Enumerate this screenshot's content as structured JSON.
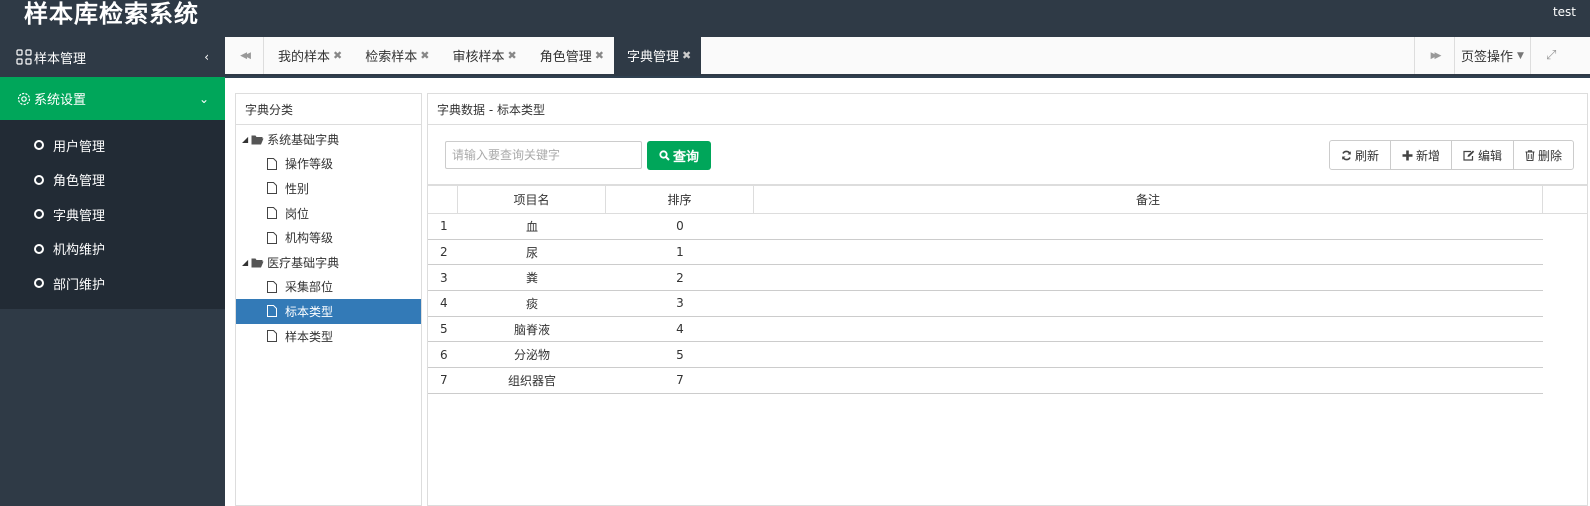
{
  "header": {
    "app_title": "样本库检索系统",
    "user": "test"
  },
  "sidebar": {
    "groups": [
      {
        "label": "样本管理",
        "arrow": "‹"
      },
      {
        "label": "系统设置",
        "arrow": "⌄"
      }
    ],
    "items": [
      {
        "label": "用户管理"
      },
      {
        "label": "角色管理"
      },
      {
        "label": "字典管理"
      },
      {
        "label": "机构维护"
      },
      {
        "label": "部门维护"
      }
    ]
  },
  "tabs": {
    "items": [
      {
        "label": "我的样本",
        "close": "✖"
      },
      {
        "label": "检索样本",
        "close": "✖"
      },
      {
        "label": "审核样本",
        "close": "✖"
      },
      {
        "label": "角色管理",
        "close": "✖"
      },
      {
        "label": "字典管理",
        "close": "✖",
        "active": true
      }
    ],
    "nav_left": "◀◀",
    "nav_right": "▶▶",
    "ops_label": "页签操作",
    "ops_caret": "▼",
    "fullscreen": "⤢"
  },
  "left_panel": {
    "title": "字典分类",
    "tree": [
      {
        "label": "系统基础字典",
        "level": 1,
        "tri": "◢"
      },
      {
        "label": "操作等级",
        "level": 2
      },
      {
        "label": "性别",
        "level": 2
      },
      {
        "label": "岗位",
        "level": 2
      },
      {
        "label": "机构等级",
        "level": 2
      },
      {
        "label": "医疗基础字典",
        "level": 1,
        "tri": "◢"
      },
      {
        "label": "采集部位",
        "level": 2
      },
      {
        "label": "标本类型",
        "level": 2,
        "selected": true
      },
      {
        "label": "样本类型",
        "level": 2
      }
    ]
  },
  "right_panel": {
    "title": "字典数据 - 标本类型",
    "search_placeholder": "请输入要查询关键字",
    "search_button": "查询",
    "buttons": {
      "refresh": "刷新",
      "add": "新增",
      "edit": "编辑",
      "delete": "删除"
    },
    "columns": [
      "",
      "项目名",
      "排序",
      "备注"
    ],
    "rows": [
      {
        "index": "1",
        "name": "血",
        "sort": "0",
        "note": ""
      },
      {
        "index": "2",
        "name": "尿",
        "sort": "1",
        "note": ""
      },
      {
        "index": "3",
        "name": "粪",
        "sort": "2",
        "note": ""
      },
      {
        "index": "4",
        "name": "痰",
        "sort": "3",
        "note": ""
      },
      {
        "index": "5",
        "name": "脑脊液",
        "sort": "4",
        "note": ""
      },
      {
        "index": "6",
        "name": "分泌物",
        "sort": "5",
        "note": ""
      },
      {
        "index": "7",
        "name": "组织器官",
        "sort": "7",
        "note": ""
      }
    ]
  },
  "colors": {
    "header_bg": "#2f3a46",
    "accent_green": "#00a65a",
    "selected_blue": "#337ab7",
    "submenu_bg": "#222b35"
  }
}
